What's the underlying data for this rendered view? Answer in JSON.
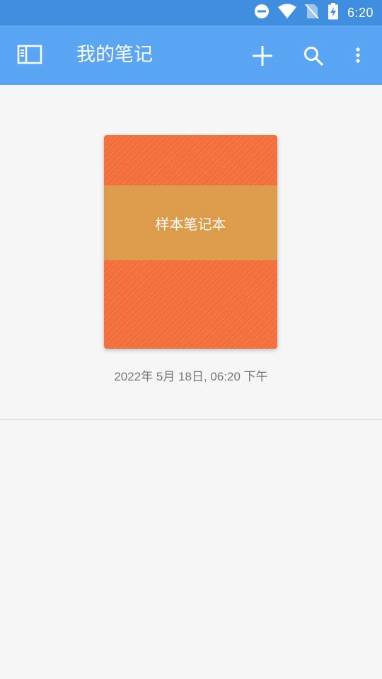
{
  "status_bar": {
    "time": "6:20",
    "icons": [
      "do-not-disturb-icon",
      "wifi-icon",
      "no-sim-icon",
      "battery-charging-icon"
    ]
  },
  "app_bar": {
    "title": "我的笔记",
    "icons": [
      "sidebar-toggle-icon",
      "add-icon",
      "search-icon",
      "more-vert-icon"
    ],
    "colors": {
      "background": "#5aa5f4",
      "status_bar": "#3f8ee0"
    }
  },
  "notebooks": [
    {
      "name": "样本笔记本",
      "date": "2022年 5月 18日, 06:20 下午",
      "cover_color": "#f7703b",
      "band_color": "#dc9c4c"
    }
  ]
}
